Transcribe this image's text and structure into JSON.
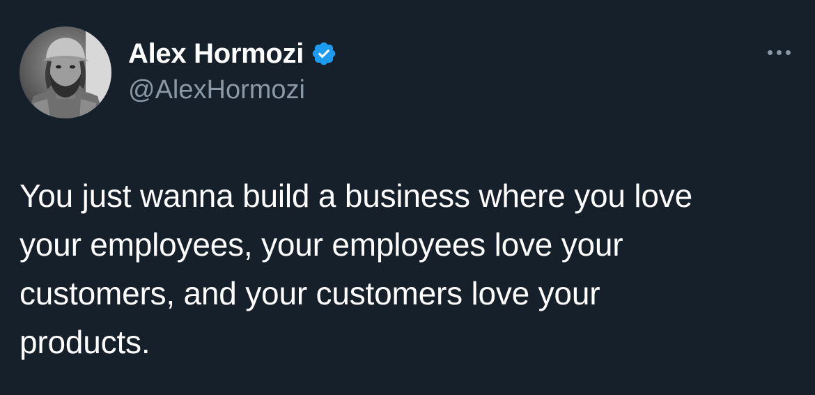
{
  "author": {
    "display_name": "Alex Hormozi",
    "handle": "@AlexHormozi",
    "verified_icon": "verified-badge-icon",
    "avatar": "profile-photo"
  },
  "menu": {
    "icon": "more-options-icon"
  },
  "tweet": {
    "lines": [
      "You just wanna build a business where you love",
      "your employees, your employees love your",
      "customers, and your customers love your",
      "products."
    ]
  },
  "colors": {
    "background": "#15202b",
    "primary_text": "#ffffff",
    "secondary_text": "#8b98a5",
    "verified_blue": "#1d9bf0"
  }
}
